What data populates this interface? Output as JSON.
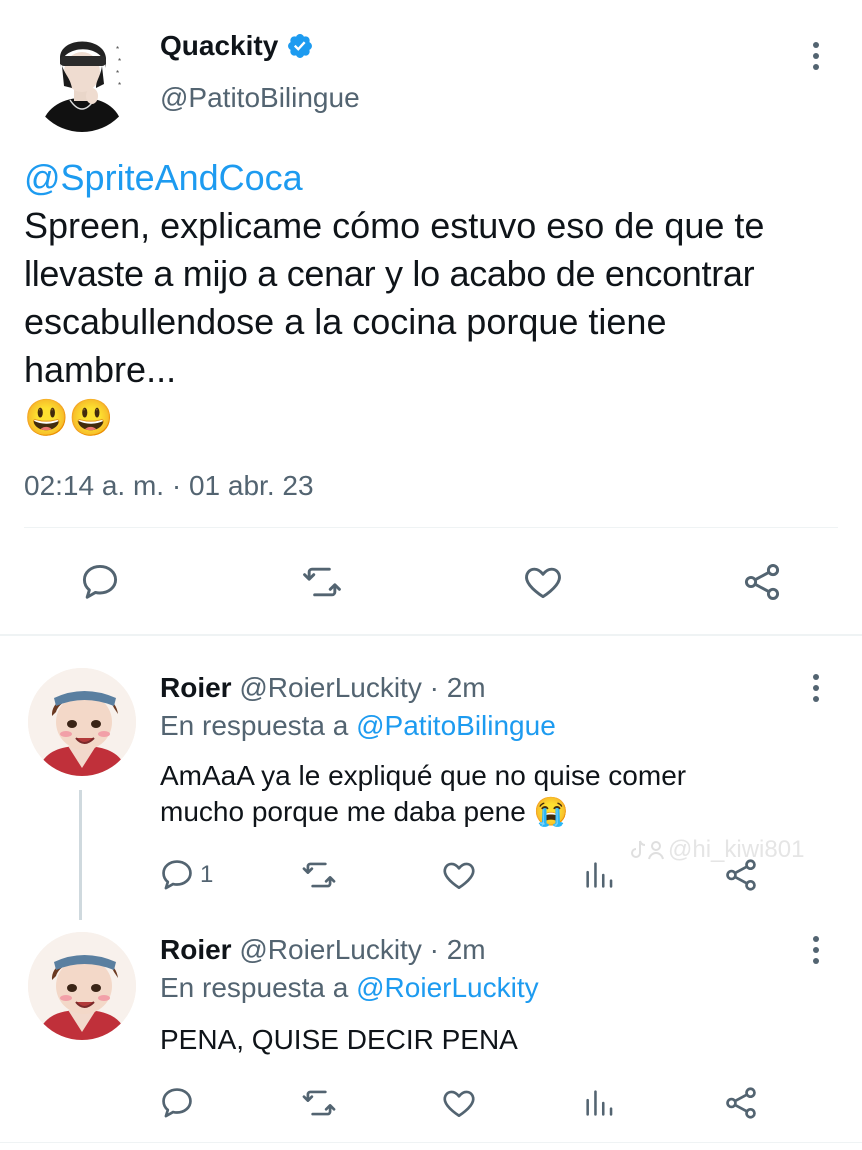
{
  "main_tweet": {
    "display_name": "Quackity",
    "handle": "@PatitoBilingue",
    "mention": "@SpriteAndCoca",
    "body_lines": [
      "Spreen, explicame cómo estuvo eso de que te",
      "llevaste a mijo a cenar y lo acabo de encontrar",
      "escabullendose a la cocina porque tiene",
      "hambre..."
    ],
    "emoji": "😃😃",
    "timestamp": "02:14 a. m. · 01 abr. 23"
  },
  "replies": [
    {
      "display_name": "Roier",
      "handle": "@RoierLuckity",
      "time": "· 2m",
      "reply_prefix": "En respuesta a",
      "reply_to": "@PatitoBilingue",
      "body_lines": [
        "AmAaA ya le expliqué que no quise comer",
        "mucho porque me daba pene"
      ],
      "emoji": "😭",
      "reply_count": "1"
    },
    {
      "display_name": "Roier",
      "handle": "@RoierLuckity",
      "time": "· 2m",
      "reply_prefix": "En respuesta a",
      "reply_to": "@RoierLuckity",
      "body_lines": [
        "PENA, QUISE DECIR PENA"
      ],
      "reply_count": ""
    }
  ],
  "watermark": "@hi_kiwi801",
  "colors": {
    "link": "#1d9bf0",
    "muted": "#536471",
    "text": "#0f1419",
    "verified": "#1d9bf0"
  },
  "icons": [
    "verified-badge-icon",
    "more-options-icon",
    "reply-icon",
    "retweet-icon",
    "like-icon",
    "share-icon",
    "analytics-icon",
    "tiktok-logo-icon"
  ]
}
